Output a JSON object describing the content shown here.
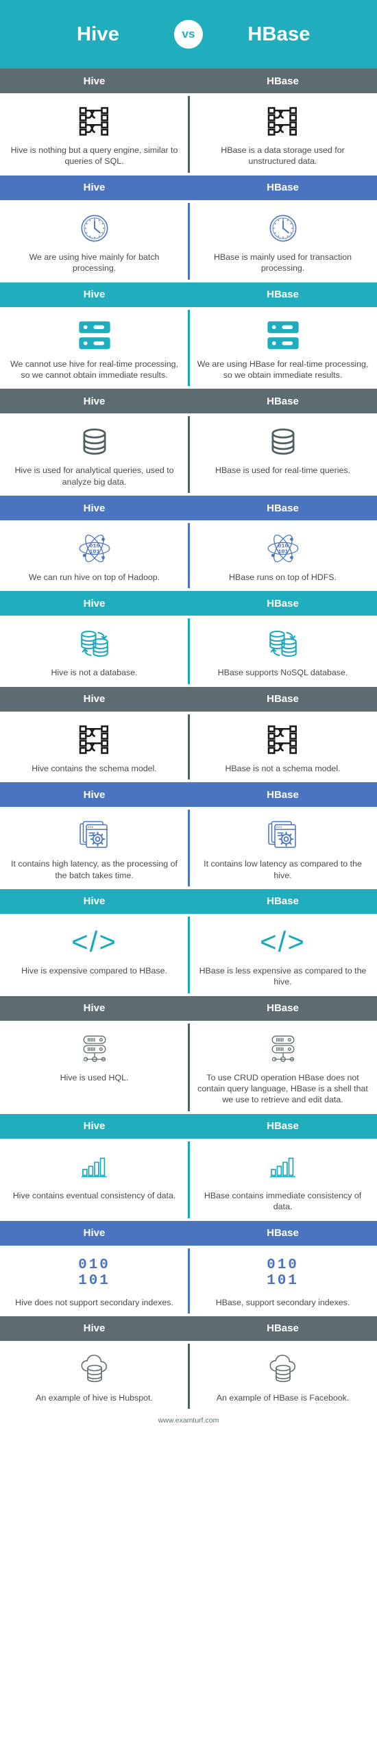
{
  "hero": {
    "left_title": "Hive",
    "vs_label": "vs",
    "right_title": "HBase",
    "background_color": "#20aebf",
    "vs_circle_color": "#ffffff"
  },
  "colors": {
    "teal": "#20aebf",
    "blue": "#4a74c0",
    "gray": "#5c6c70",
    "body_text": "#4a4a4a"
  },
  "band_labels": {
    "left": "Hive",
    "right": "HBase"
  },
  "footer": {
    "url": "www.examturf.com"
  },
  "rows": [
    {
      "band_color": "gray",
      "icon": "schema-flowchart-icon",
      "left_text": "Hive is nothing but a query engine, similar to queries of SQL.",
      "right_text": "HBase is a data storage used for unstructured data."
    },
    {
      "band_color": "blue",
      "icon": "clock-icon",
      "left_text": "We are using hive mainly for batch processing.",
      "right_text": "HBase is mainly used for transaction processing."
    },
    {
      "band_color": "teal",
      "icon": "server-rack-icon",
      "left_text": "We cannot use hive for real-time processing, so we cannot obtain immediate results.",
      "right_text": "We are using HBase for real-time processing, so we obtain immediate results."
    },
    {
      "band_color": "gray",
      "icon": "database-cylinder-icon",
      "left_text": "Hive is used for analytical queries, used to analyze big data.",
      "right_text": "HBase is used for real-time queries."
    },
    {
      "band_color": "blue",
      "icon": "atom-binary-icon",
      "left_text": "We can run hive on top of Hadoop.",
      "right_text": "HBase runs on top of HDFS."
    },
    {
      "band_color": "teal",
      "icon": "database-sync-icon",
      "left_text": "Hive is not a database.",
      "right_text": "HBase supports NoSQL database."
    },
    {
      "band_color": "gray",
      "icon": "schema-flowchart-icon",
      "left_text": "Hive contains the schema model.",
      "right_text": "HBase is not a schema model."
    },
    {
      "band_color": "blue",
      "icon": "window-gear-icon",
      "left_text": "It contains high latency, as the processing of the batch takes time.",
      "right_text": "It contains low latency as compared to the hive."
    },
    {
      "band_color": "teal",
      "icon": "code-tag-icon",
      "left_text": "Hive is expensive compared to HBase.",
      "right_text": "HBase is less expensive as compared to the hive."
    },
    {
      "band_color": "gray",
      "icon": "server-network-icon",
      "left_text": "Hive is used HQL.",
      "right_text": "To use CRUD operation HBase does not contain query language, HBase is a shell that we use to retrieve and edit data."
    },
    {
      "band_color": "teal",
      "icon": "bar-chart-icon",
      "left_text": "Hive contains eventual consistency of data.",
      "right_text": "HBase contains immediate consistency of data."
    },
    {
      "band_color": "blue",
      "icon": "binary-digits-icon",
      "icon_text_line1": "010",
      "icon_text_line2": "101",
      "left_text": "Hive does not support secondary indexes.",
      "right_text": "HBase, support secondary indexes."
    },
    {
      "band_color": "gray",
      "icon": "cloud-database-icon",
      "left_text": "An example of hive is Hubspot.",
      "right_text": "An example of HBase is Facebook."
    }
  ]
}
